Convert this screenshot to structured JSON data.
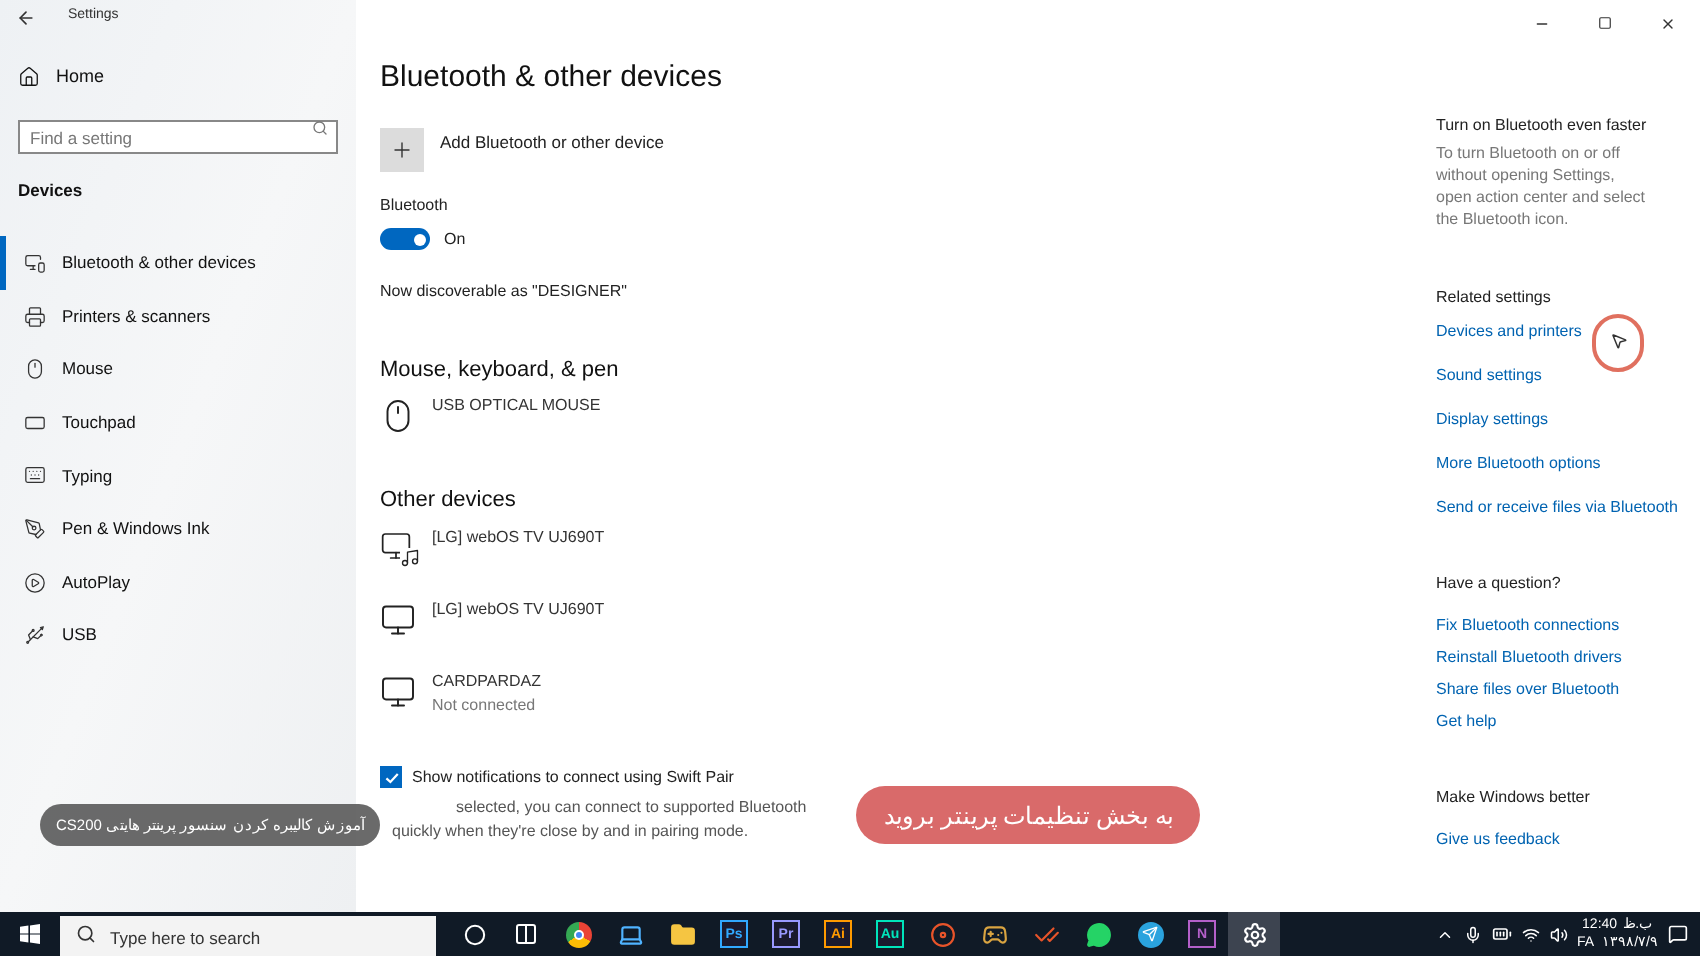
{
  "window": {
    "title": "Settings"
  },
  "sidebar": {
    "home": "Home",
    "search": {
      "placeholder": "Find a setting"
    },
    "section": "Devices",
    "items": [
      {
        "label": "Bluetooth & other devices",
        "kind": "devices",
        "selected": true
      },
      {
        "label": "Printers & scanners",
        "kind": "printer",
        "selected": false
      },
      {
        "label": "Mouse",
        "kind": "mouse",
        "selected": false
      },
      {
        "label": "Touchpad",
        "kind": "touchpad",
        "selected": false
      },
      {
        "label": "Typing",
        "kind": "keyboard",
        "selected": false
      },
      {
        "label": "Pen & Windows Ink",
        "kind": "pen",
        "selected": false
      },
      {
        "label": "AutoPlay",
        "kind": "autoplay",
        "selected": false
      },
      {
        "label": "USB",
        "kind": "usb",
        "selected": false
      }
    ]
  },
  "main": {
    "title": "Bluetooth & other devices",
    "add_button": "Add Bluetooth or other device",
    "bluetooth": {
      "label": "Bluetooth",
      "on": true,
      "state_text": "On"
    },
    "discoverable": "Now discoverable as \"DESIGNER\"",
    "sections": [
      {
        "heading": "Mouse, keyboard, & pen",
        "devices": [
          {
            "name": "USB OPTICAL MOUSE",
            "kind": "mouse"
          }
        ]
      },
      {
        "heading": "Other devices",
        "devices": [
          {
            "name": "[LG] webOS TV UJ690T",
            "kind": "media"
          },
          {
            "name": "[LG] webOS TV UJ690T",
            "kind": "display"
          },
          {
            "name": "CARDPARDAZ",
            "status": "Not connected",
            "kind": "display"
          }
        ]
      }
    ],
    "swift_pair": {
      "label": "Show notifications to connect using Swift Pair",
      "checked": true,
      "description": [
        "selected, you can connect to supported Bluetooth",
        "quickly when they're close by and in pairing mode."
      ]
    }
  },
  "right": {
    "tip": {
      "heading": "Turn on Bluetooth even faster",
      "text": "To turn Bluetooth on or off without opening Settings, open action center and select the Bluetooth icon."
    },
    "groups": [
      {
        "heading": "Related settings",
        "links": [
          "Devices and printers",
          "Sound settings",
          "Display settings",
          "More Bluetooth options",
          "Send or receive files via Bluetooth"
        ]
      },
      {
        "heading": "Have a question?",
        "links": [
          "Fix Bluetooth connections",
          "Reinstall Bluetooth drivers",
          "Share files over Bluetooth",
          "Get help"
        ]
      },
      {
        "heading": "Make Windows better",
        "links": [
          "Give us feedback"
        ]
      }
    ]
  },
  "overlays": {
    "video_title": "آموزش کالیبره کردن سنسور پرینتر هایتی CS200",
    "caption": "به بخش تنظیمات پرینتر بروید"
  },
  "taskbar": {
    "search_placeholder": "Type here to search",
    "apps": [
      {
        "kind": "cortana",
        "selected": false
      },
      {
        "kind": "taskview",
        "selected": false
      },
      {
        "kind": "browser",
        "selected": false
      },
      {
        "kind": "pc",
        "selected": false
      },
      {
        "kind": "folder",
        "selected": false
      },
      {
        "kind": "letter",
        "label": "Ps",
        "color": "#31a8ff",
        "selected": false
      },
      {
        "kind": "letter",
        "label": "Pr",
        "color": "#9999ff",
        "selected": false
      },
      {
        "kind": "letter",
        "label": "Ai",
        "color": "#ff9a00",
        "selected": false
      },
      {
        "kind": "letter",
        "label": "Au",
        "color": "#00e4bb",
        "selected": false
      },
      {
        "kind": "record",
        "selected": false
      },
      {
        "kind": "game",
        "selected": false
      },
      {
        "kind": "check",
        "selected": false
      },
      {
        "kind": "chat",
        "selected": false
      },
      {
        "kind": "send",
        "selected": false
      },
      {
        "kind": "letter",
        "label": "N",
        "color": "#b45fc9",
        "selected": false
      },
      {
        "kind": "settings",
        "selected": true
      }
    ],
    "tray": {
      "time": "12:40",
      "period": "ب.ظ",
      "language": "FA",
      "date": "۱۳۹۸/۷/۹"
    }
  }
}
